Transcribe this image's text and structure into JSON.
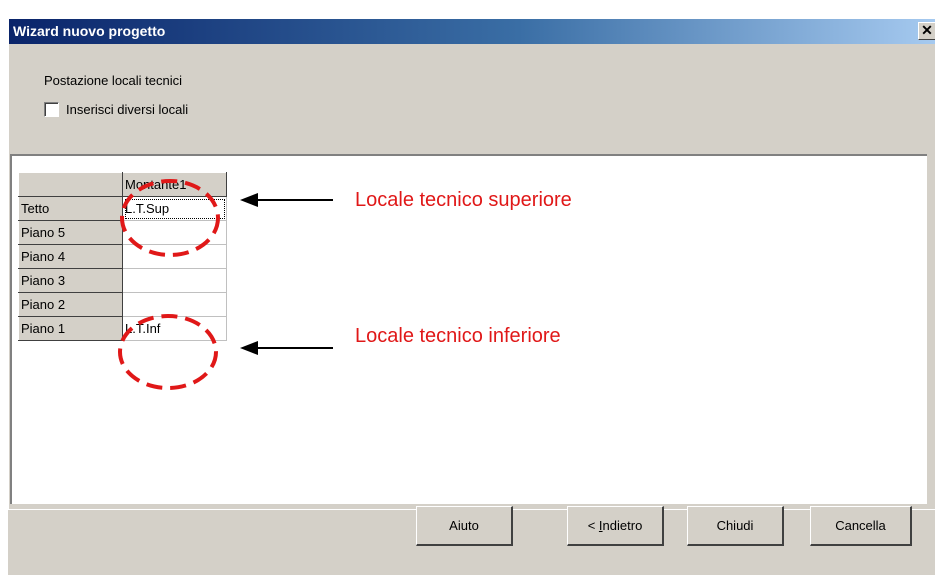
{
  "window": {
    "title": "Wizard nuovo progetto",
    "close_glyph": "✕"
  },
  "section_label": "Postazione locali tecnici",
  "checkbox": {
    "label": "Inserisci diversi locali",
    "checked": false
  },
  "grid": {
    "column_header": "Montante1",
    "rows": [
      {
        "label": "Tetto",
        "value": "L.T.Sup"
      },
      {
        "label": "Piano 5",
        "value": ""
      },
      {
        "label": "Piano 4",
        "value": ""
      },
      {
        "label": "Piano 3",
        "value": ""
      },
      {
        "label": "Piano 2",
        "value": ""
      },
      {
        "label": "Piano 1",
        "value": "L.T.Inf"
      }
    ]
  },
  "annotations": {
    "top": "Locale tecnico superiore",
    "bottom": "Locale tecnico inferiore",
    "color": "#e01818"
  },
  "buttons": {
    "help": "Aiuto",
    "back_prefix": "< ",
    "back_mnemonic": "I",
    "back_rest": "ndietro",
    "close": "Chiudi",
    "cancel": "Cancella"
  }
}
